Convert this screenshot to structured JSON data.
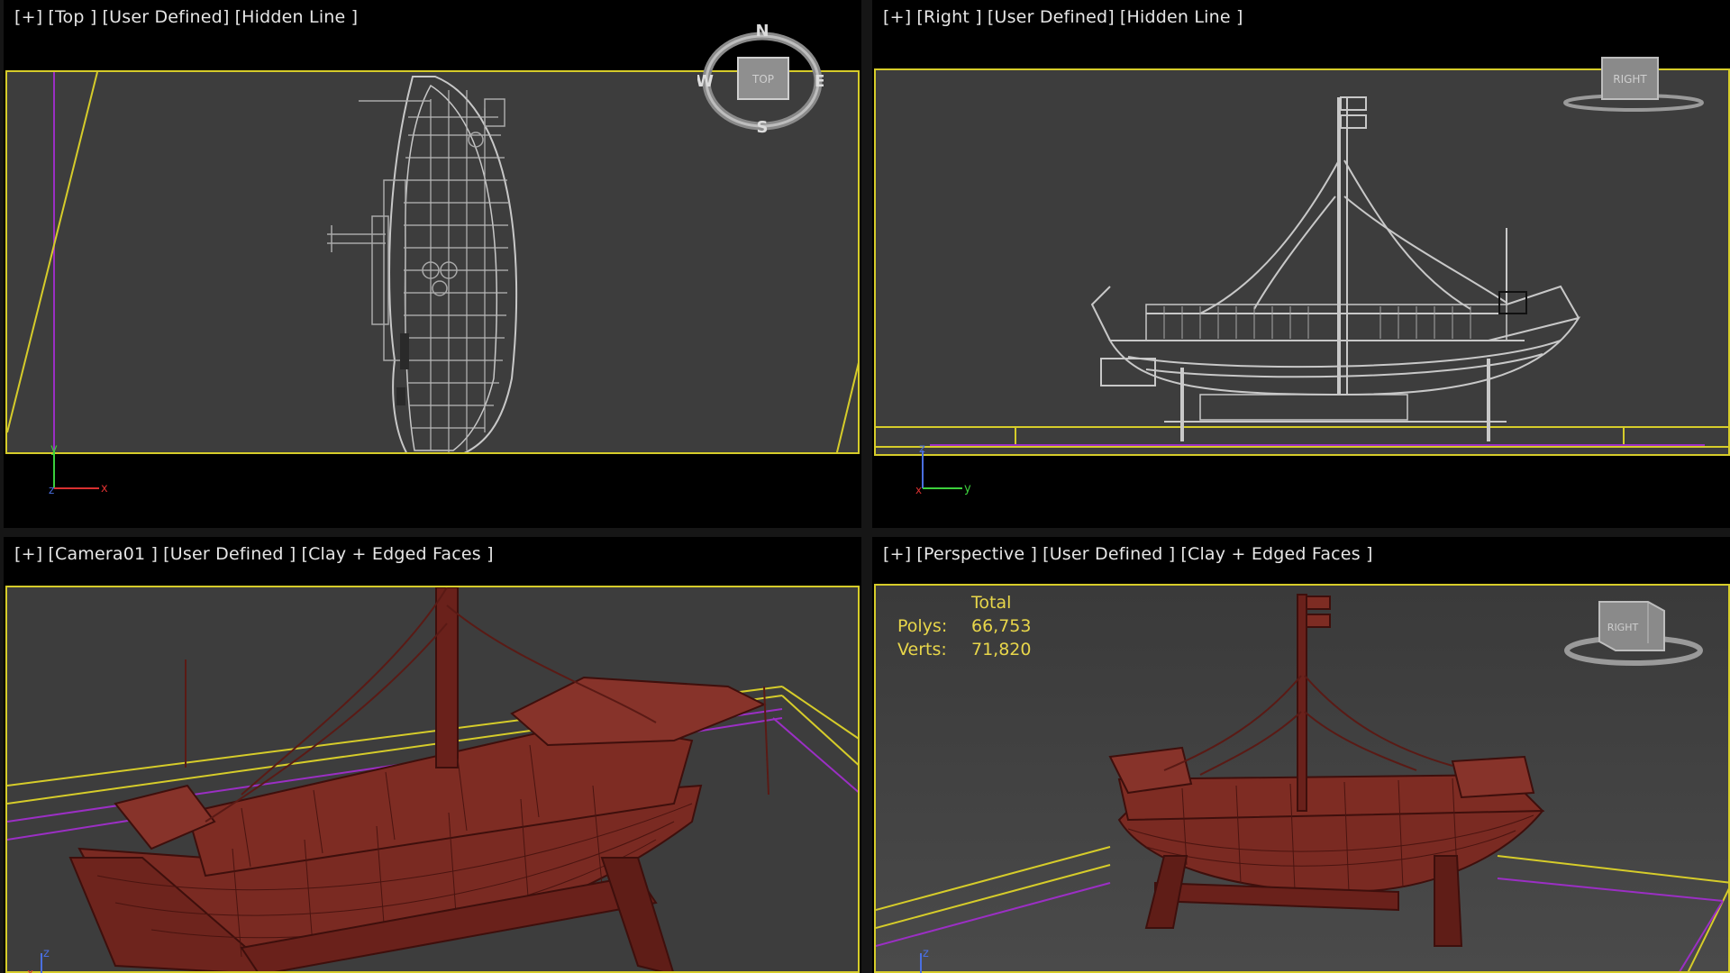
{
  "viewports": [
    {
      "id": "top",
      "labels": [
        "[+]",
        "[Top ]",
        "[User Defined]",
        "[Hidden Line ]"
      ],
      "compass": {
        "n": "N",
        "s": "S",
        "e": "E",
        "w": "W",
        "cube": "TOP"
      },
      "axes": {
        "a": "y",
        "b": "x",
        "c": "z"
      }
    },
    {
      "id": "right",
      "labels": [
        "[+]",
        "[Right ]",
        "[User Defined]",
        "[Hidden Line ]"
      ],
      "cube": "RIGHT",
      "axes": {
        "a": "z",
        "b": "y",
        "c": "x"
      }
    },
    {
      "id": "camera",
      "labels": [
        "[+]",
        "[Camera01 ]",
        "[User Defined ]",
        "[Clay + Edged Faces ]"
      ],
      "axes": {
        "a": "z",
        "b": "x"
      }
    },
    {
      "id": "perspective",
      "labels": [
        "[+]",
        "[Perspective ]",
        "[User Defined ]",
        "[Clay + Edged Faces ]"
      ],
      "cube": "RIGHT",
      "axes": {
        "a": "z"
      },
      "stats": {
        "header": "Total",
        "rows": [
          {
            "label": "Polys:",
            "value": "66,753"
          },
          {
            "label": "Verts:",
            "value": "71,820"
          }
        ]
      }
    }
  ],
  "colors": {
    "viewport_bg": "#3d3d3d",
    "border_active": "#d6cc2a",
    "wire": "#c8c8c8",
    "clay": "#7a2a22",
    "clay_edge": "#3e0f0c",
    "grid_purple": "#9b2fc4",
    "grid_yellow": "#d6cc2a",
    "stats_text": "#e8d64a"
  }
}
